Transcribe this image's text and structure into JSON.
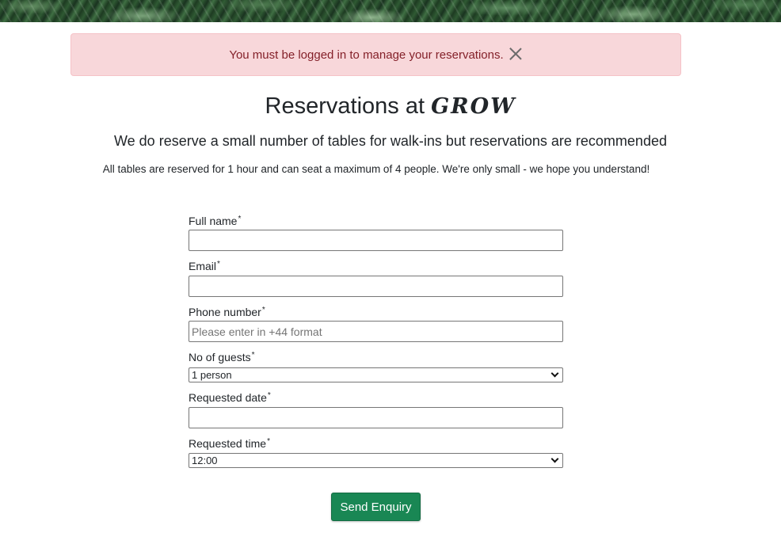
{
  "alert": {
    "message": "You must be logged in to manage your reservations.",
    "close_icon": "close-icon"
  },
  "heading": {
    "prefix": "Reservations at",
    "brand": "GROW"
  },
  "subtitle": "We do reserve a small number of tables for walk-ins but reservations are recommended",
  "note": "All tables are reserved for 1 hour and can seat a maximum of 4 people. We're only small - we hope you understand!",
  "form": {
    "required_marker": "*",
    "full_name": {
      "label": "Full name",
      "value": ""
    },
    "email": {
      "label": "Email",
      "value": ""
    },
    "phone": {
      "label": "Phone number",
      "value": "",
      "placeholder": "Please enter in +44 format"
    },
    "guests": {
      "label": "No of guests",
      "selected": "1 person"
    },
    "date": {
      "label": "Requested date",
      "value": ""
    },
    "time": {
      "label": "Requested time",
      "selected": "12:00"
    },
    "submit_label": "Send Enquiry"
  },
  "colors": {
    "alert_bg": "#f8d7da",
    "alert_text": "#842029",
    "button_bg": "#198754"
  }
}
